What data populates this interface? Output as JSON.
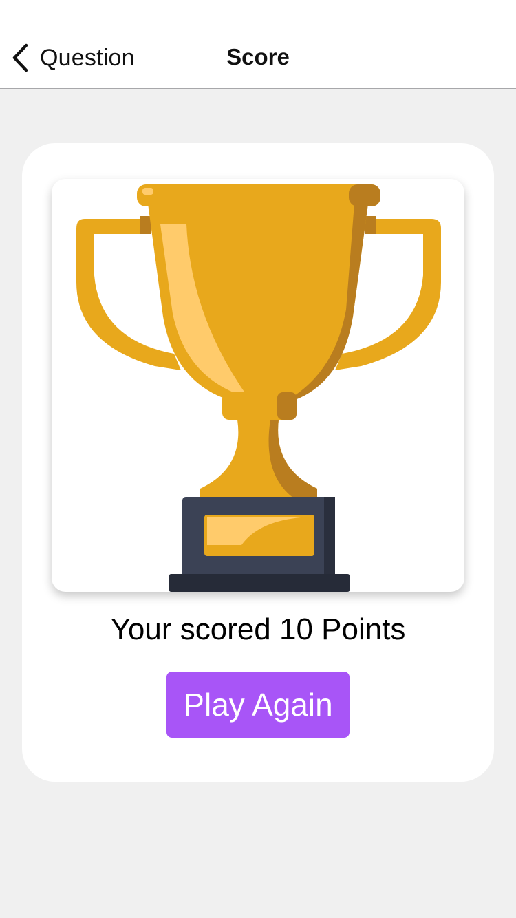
{
  "navbar": {
    "back_label": "Question",
    "title": "Score"
  },
  "card": {
    "image_alt": "trophy",
    "score_text": "Your scored 10 Points",
    "play_again_label": "Play Again"
  },
  "colors": {
    "accent": "#a855f7",
    "trophy_gold": "#e8a81c",
    "trophy_shade": "#b97d1f",
    "trophy_highlight": "#ffcb6b",
    "base_dark": "#2f3646"
  }
}
